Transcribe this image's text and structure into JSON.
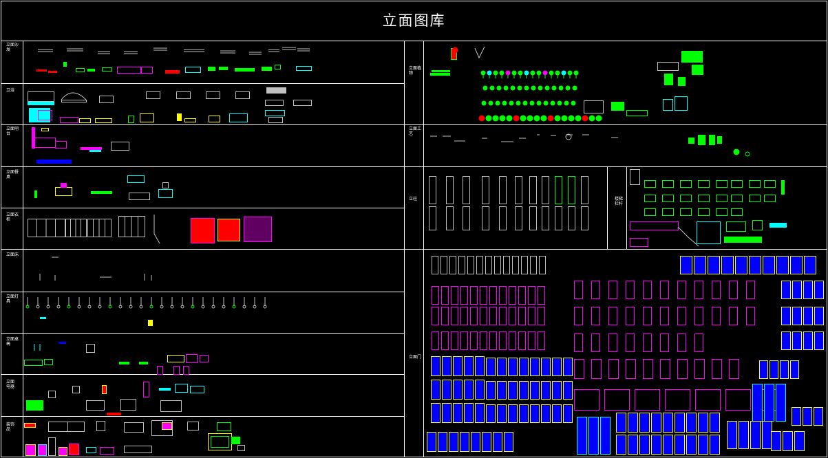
{
  "title": "立面图库",
  "sections": {
    "left": [
      {
        "id": "l1",
        "label": "立面沙发"
      },
      {
        "id": "l2",
        "label": "卫浴"
      },
      {
        "id": "l3",
        "label": "立面吧台"
      },
      {
        "id": "l4",
        "label": "立面餐桌"
      },
      {
        "id": "l5",
        "label": "立面衣柜"
      },
      {
        "id": "l6",
        "label": "立面床"
      },
      {
        "id": "l7",
        "label": "立面灯具"
      },
      {
        "id": "l8",
        "label": "立面桌椅"
      },
      {
        "id": "l9",
        "label": "立面电器"
      },
      {
        "id": "l10",
        "label": "装饰品"
      }
    ],
    "right": [
      {
        "id": "r1",
        "label": "立面植物"
      },
      {
        "id": "r2",
        "label": "立面工艺"
      },
      {
        "id": "r3",
        "label": "立柱"
      },
      {
        "id": "r4",
        "label": "楼梯栏杆"
      },
      {
        "id": "r5",
        "label": "立面门"
      }
    ]
  },
  "colors": {
    "background": "#000000",
    "grid": "#ffffff",
    "green": "#00ff00",
    "magenta": "#ff00ff",
    "yellow": "#ffff00",
    "cyan": "#00ffff",
    "blue": "#0000ff",
    "red": "#ff0000",
    "gray": "#c0c0c0"
  }
}
